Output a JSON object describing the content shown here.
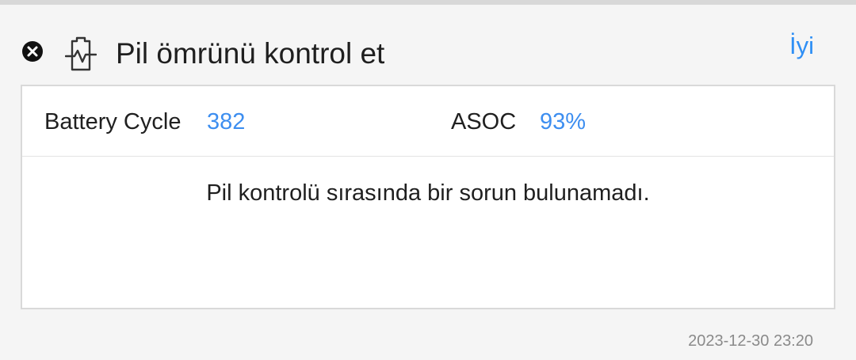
{
  "header": {
    "title": "Pil ömrünü kontrol et",
    "status": "İyi"
  },
  "stats": {
    "battery_cycle_label": "Battery Cycle",
    "battery_cycle_value": "382",
    "asoc_label": "ASOC",
    "asoc_value": "93%"
  },
  "message": "Pil kontrolü sırasında bir sorun bulunamadı.",
  "timestamp": "2023-12-30 23:20",
  "icons": {
    "close": "close-icon",
    "battery": "battery-health-icon"
  },
  "colors": {
    "accent": "#2f8ff5",
    "text": "#1f1f1f",
    "muted": "#8a8a8a"
  }
}
